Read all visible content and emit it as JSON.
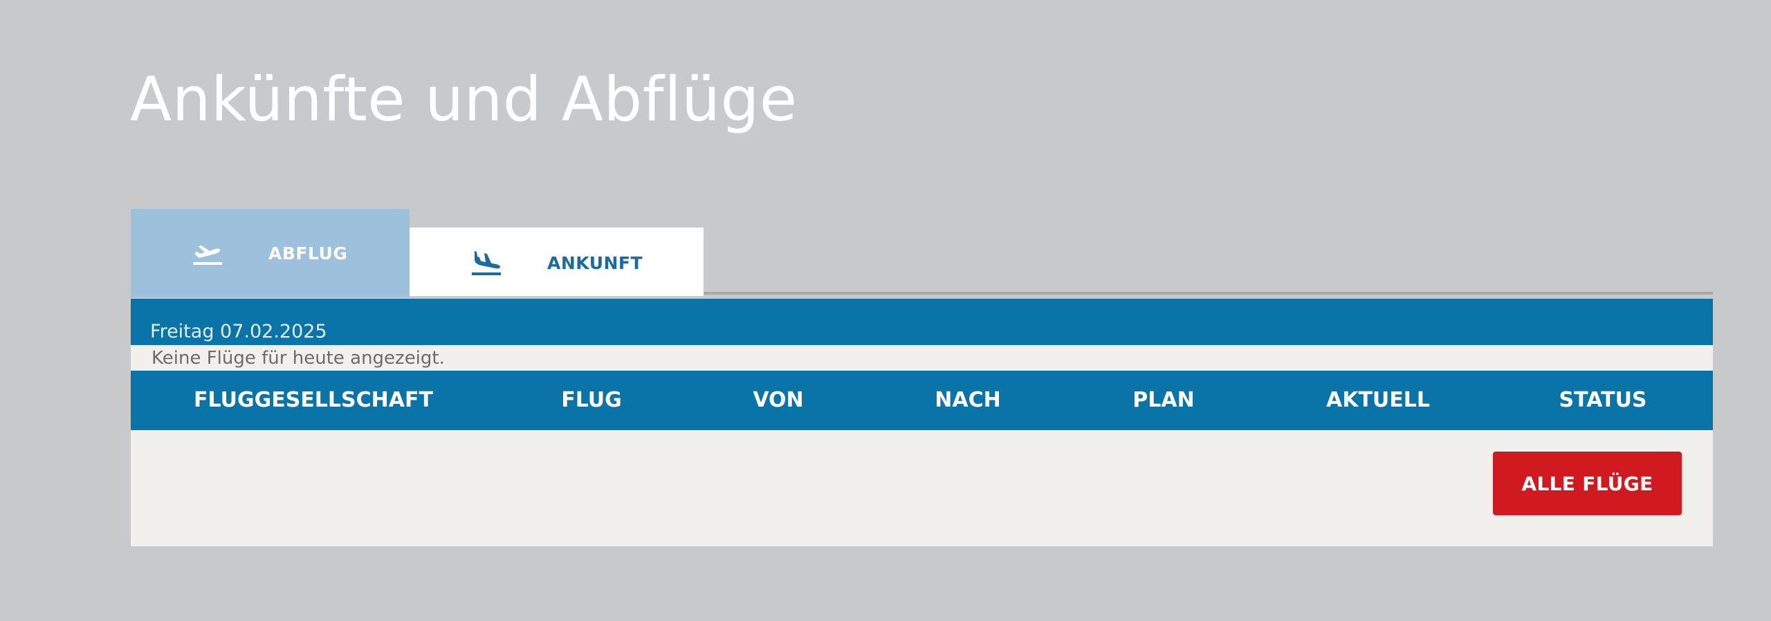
{
  "page": {
    "title": "Ankünfte und Abflüge"
  },
  "tabs": [
    {
      "label": "ABFLUG",
      "icon": "plane-departure-icon",
      "active": true
    },
    {
      "label": "ANKUNFT",
      "icon": "plane-arrival-icon",
      "active": false
    }
  ],
  "schedule": {
    "date_label": "Freitag 07.02.2025",
    "notice": "Keine Flüge für heute angezeigt."
  },
  "table": {
    "columns": [
      "FLUGGESELLSCHAFT",
      "FLUG",
      "VON",
      "NACH",
      "PLAN",
      "AKTUELL",
      "STATUS"
    ],
    "rows": []
  },
  "actions": {
    "all_flights_label": "ALLE FLÜGE"
  },
  "colors": {
    "background": "#c8c9cb",
    "primary_blue": "#0a73a8",
    "active_tab": "#9dc0dd",
    "inactive_tab": "#ffffff",
    "accent_red": "#d01a1f",
    "panel": "#f1f0ed"
  }
}
